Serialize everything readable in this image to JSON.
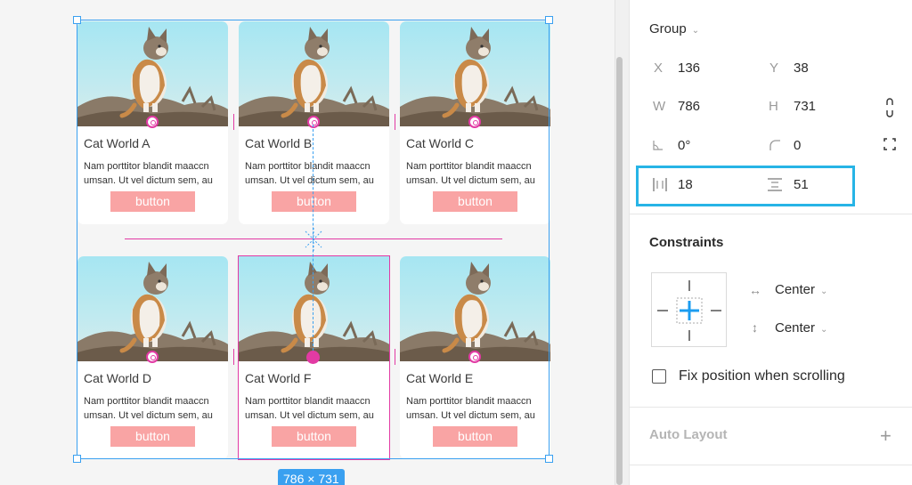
{
  "canvas": {
    "size_badge": "786 × 731",
    "cards": [
      {
        "title": "Cat World A",
        "description": "Nam porttitor blandit maaccn umsan. Ut vel dictum sem, au",
        "button_label": "button"
      },
      {
        "title": "Cat World B",
        "description": "Nam porttitor blandit maaccn umsan. Ut vel dictum sem, au",
        "button_label": "button"
      },
      {
        "title": "Cat World C",
        "description": "Nam porttitor blandit maaccn umsan. Ut vel dictum sem, au",
        "button_label": "button"
      },
      {
        "title": "Cat World D",
        "description": "Nam porttitor blandit maaccn umsan. Ut vel dictum sem, au",
        "button_label": "button"
      },
      {
        "title": "Cat World F",
        "description": "Nam porttitor blandit maaccn umsan. Ut vel dictum sem, au",
        "button_label": "button"
      },
      {
        "title": "Cat World E",
        "description": "Nam porttitor blandit maaccn umsan. Ut vel dictum sem, au",
        "button_label": "button"
      }
    ],
    "colors": {
      "selection": "#3aa0f0",
      "guide": "#e23aa4",
      "button": "#f9a4a4"
    }
  },
  "inspector": {
    "group_label": "Group",
    "x_label": "X",
    "x_value": "136",
    "y_label": "Y",
    "y_value": "38",
    "w_label": "W",
    "w_value": "786",
    "h_label": "H",
    "h_value": "731",
    "rotation_value": "0°",
    "radius_value": "0",
    "horizontal_spacing_value": "18",
    "vertical_spacing_value": "51",
    "constraints_title": "Constraints",
    "horizontal_constraint": "Center",
    "vertical_constraint": "Center",
    "fix_position_label": "Fix position when scrolling",
    "auto_layout_title": "Auto Layout",
    "highlight_color": "#27b4e6"
  }
}
